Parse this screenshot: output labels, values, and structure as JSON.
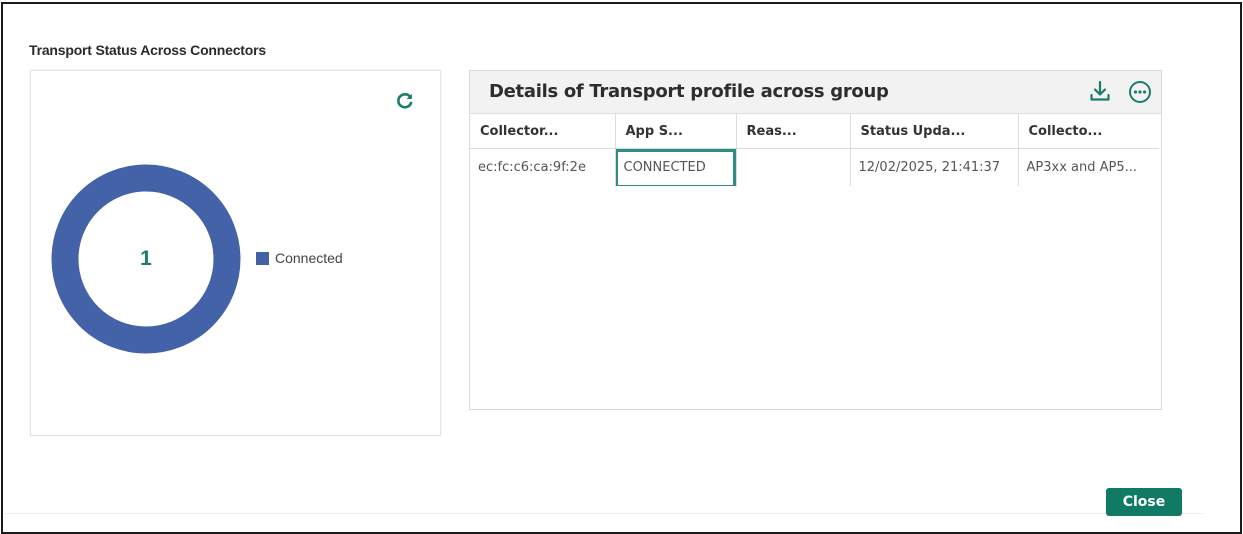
{
  "modal": {
    "title": "Transport Status Across Connectors",
    "close_label": "Close"
  },
  "chart_card": {
    "refresh_icon": "refresh-icon",
    "center_value": "1",
    "chart_data": {
      "type": "pie",
      "categories": [
        "Connected"
      ],
      "values": [
        1
      ],
      "title": "",
      "colors": [
        "#4462a8"
      ],
      "legend_placement": "right"
    },
    "legend": [
      {
        "label": "Connected",
        "color": "#4462a8"
      }
    ]
  },
  "details": {
    "title": "Details of Transport profile across group",
    "download_icon": "download-icon",
    "more_icon": "more-options-icon",
    "columns": [
      "Collector...",
      "App S...",
      "Reas...",
      "Status Upda...",
      "Collecto..."
    ],
    "rows": [
      [
        "ec:fc:c6:ca:9f:2e",
        "CONNECTED",
        "",
        "12/02/2025, 21:41:37",
        "AP3xx and AP5..."
      ]
    ]
  },
  "colors": {
    "accent": "#117a65",
    "highlight": "#2e8c82",
    "series": "#4462a8"
  }
}
